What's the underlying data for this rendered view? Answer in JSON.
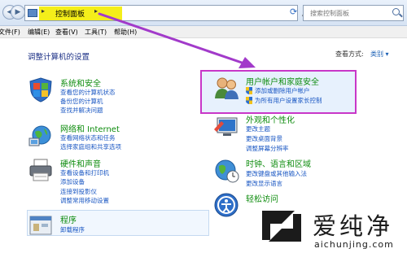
{
  "address": {
    "crumb": "控制面板",
    "search_placeholder": "搜索控制面板"
  },
  "menu": [
    "文件(F)",
    "编辑(E)",
    "查看(V)",
    "工具(T)",
    "帮助(H)"
  ],
  "page_title": "调整计算机的设置",
  "view_by": {
    "label": "查看方式:",
    "value": "类别 ▾"
  },
  "categories": [
    {
      "title": "系统和安全",
      "links": [
        "查看您的计算机状态",
        "备份您的计算机",
        "查找并解决问题"
      ]
    },
    {
      "title": "网络和 Internet",
      "links": [
        "查看网络状态和任务",
        "选择家庭组和共享选项"
      ]
    },
    {
      "title": "硬件和声音",
      "links": [
        "查看设备和打印机",
        "添加设备",
        "连接到投影仪",
        "调整常用移动设置"
      ]
    },
    {
      "title": "程序",
      "links": [
        "卸载程序"
      ]
    },
    {
      "title": "用户帐户和家庭安全",
      "links": [
        "添加或删除用户帐户",
        "为所有用户设置家长控制"
      ]
    },
    {
      "title": "外观和个性化",
      "links": [
        "更改主题",
        "更改桌面背景",
        "调整屏幕分辨率"
      ]
    },
    {
      "title": "时钟、语言和区域",
      "links": [
        "更改键盘或其他输入法",
        "更改显示语言"
      ]
    },
    {
      "title": "轻松访问",
      "links": []
    }
  ],
  "watermark": {
    "brand": "爱纯净",
    "url": "aichunjing.com"
  },
  "colors": {
    "highlight": "#c837c8",
    "crumb_highlight": "#f4ee1a",
    "category_green": "#0e8c0e",
    "link_blue": "#1a57c3"
  }
}
